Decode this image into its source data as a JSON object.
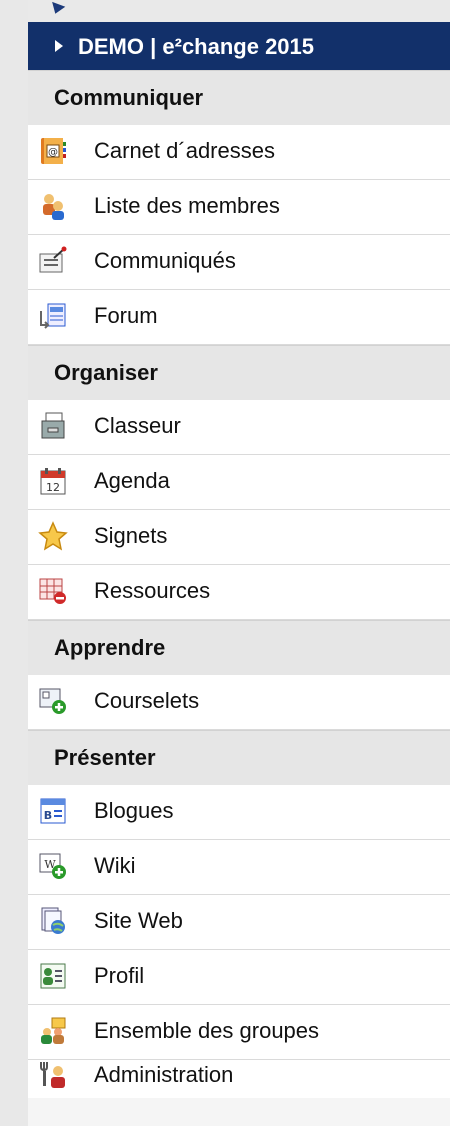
{
  "header": {
    "title": "DEMO | e²change 2015"
  },
  "sections": [
    {
      "label": "Communiquer",
      "items": [
        {
          "label": "Carnet d´adresses",
          "icon": "address-book-icon"
        },
        {
          "label": "Liste des membres",
          "icon": "members-icon"
        },
        {
          "label": "Communiqués",
          "icon": "announcement-icon"
        },
        {
          "label": "Forum",
          "icon": "forum-icon"
        }
      ]
    },
    {
      "label": "Organiser",
      "items": [
        {
          "label": "Classeur",
          "icon": "binder-icon"
        },
        {
          "label": "Agenda",
          "icon": "calendar-icon"
        },
        {
          "label": "Signets",
          "icon": "star-icon"
        },
        {
          "label": "Ressources",
          "icon": "resources-icon"
        }
      ]
    },
    {
      "label": "Apprendre",
      "items": [
        {
          "label": "Courselets",
          "icon": "courselets-icon"
        }
      ]
    },
    {
      "label": "Présenter",
      "items": [
        {
          "label": "Blogues",
          "icon": "blog-icon"
        },
        {
          "label": "Wiki",
          "icon": "wiki-icon"
        },
        {
          "label": "Site Web",
          "icon": "website-icon"
        },
        {
          "label": "Profil",
          "icon": "profile-icon"
        },
        {
          "label": "Ensemble des groupes",
          "icon": "groups-icon"
        },
        {
          "label": "Administration",
          "icon": "admin-tools-icon"
        }
      ]
    }
  ],
  "colors": {
    "header_bg": "#12306a",
    "section_bg": "#e6e6e6",
    "item_bg": "#ffffff"
  }
}
